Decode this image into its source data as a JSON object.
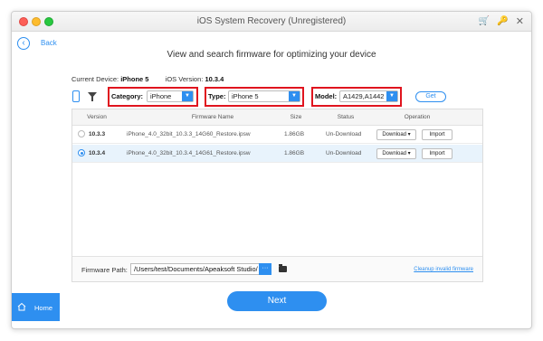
{
  "window": {
    "title": "iOS System Recovery (Unregistered)",
    "title_icons": [
      "cart-icon",
      "key-icon",
      "close-icon"
    ]
  },
  "nav": {
    "back_label": "Back"
  },
  "heading": "View and search firmware for optimizing your device",
  "device": {
    "current_label": "Current Device:",
    "current_value": "iPhone 5",
    "ios_label": "iOS Version:",
    "ios_value": "10.3.4"
  },
  "filters": {
    "category_label": "Category:",
    "category_value": "iPhone",
    "type_label": "Type:",
    "type_value": "iPhone 5",
    "model_label": "Model:",
    "model_value": "A1429,A1442",
    "get_label": "Get"
  },
  "table": {
    "headers": [
      "Version",
      "Firmware Name",
      "Size",
      "Status",
      "Operation"
    ],
    "rows": [
      {
        "version": "10.3.3",
        "firmware": "iPhone_4.0_32bit_10.3.3_14G60_Restore.ipsw",
        "size": "1.86GB",
        "status": "Un-Download",
        "download": "Download",
        "import": "Import",
        "selected": false
      },
      {
        "version": "10.3.4",
        "firmware": "iPhone_4.0_32bit_10.3.4_14G61_Restore.ipsw",
        "size": "1.86GB",
        "status": "Un-Download",
        "download": "Download",
        "import": "Import",
        "selected": true
      }
    ]
  },
  "path": {
    "label": "Firmware Path:",
    "value": "/Users/test/Documents/Apeaksoft Studio/",
    "browse": "···",
    "cleanup": "Cleanup invalid firmware"
  },
  "footer": {
    "home_label": "Home",
    "next_label": "Next"
  },
  "colors": {
    "accent": "#2e8ff0",
    "highlight_box": "#e0141e",
    "selected_row": "#e8f3fc"
  }
}
